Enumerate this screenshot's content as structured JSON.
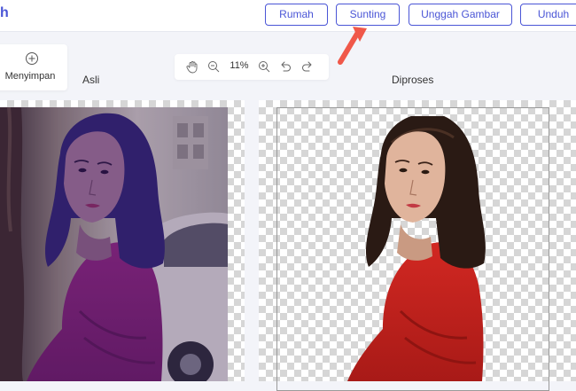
{
  "header": {
    "logo_text": "h",
    "nav": {
      "home": "Rumah",
      "edit": "Sunting",
      "upload": "Unggah Gambar",
      "download": "Unduh"
    }
  },
  "save_panel": {
    "icon": "plus-circle-icon",
    "label": "Menyimpan"
  },
  "toolbar": {
    "tools": [
      "hand-icon",
      "zoom-out-icon",
      "zoom-in-icon",
      "undo-icon",
      "redo-icon"
    ],
    "zoom_value": "11%"
  },
  "labels": {
    "original": "Asli",
    "processed": "Diproses"
  },
  "colors": {
    "accent": "#4a55d6",
    "annotation_arrow": "#f0584a",
    "sweater_processed": "#c0201c",
    "sweater_original": "#7c1d67",
    "hair_original": "#2e2268"
  }
}
